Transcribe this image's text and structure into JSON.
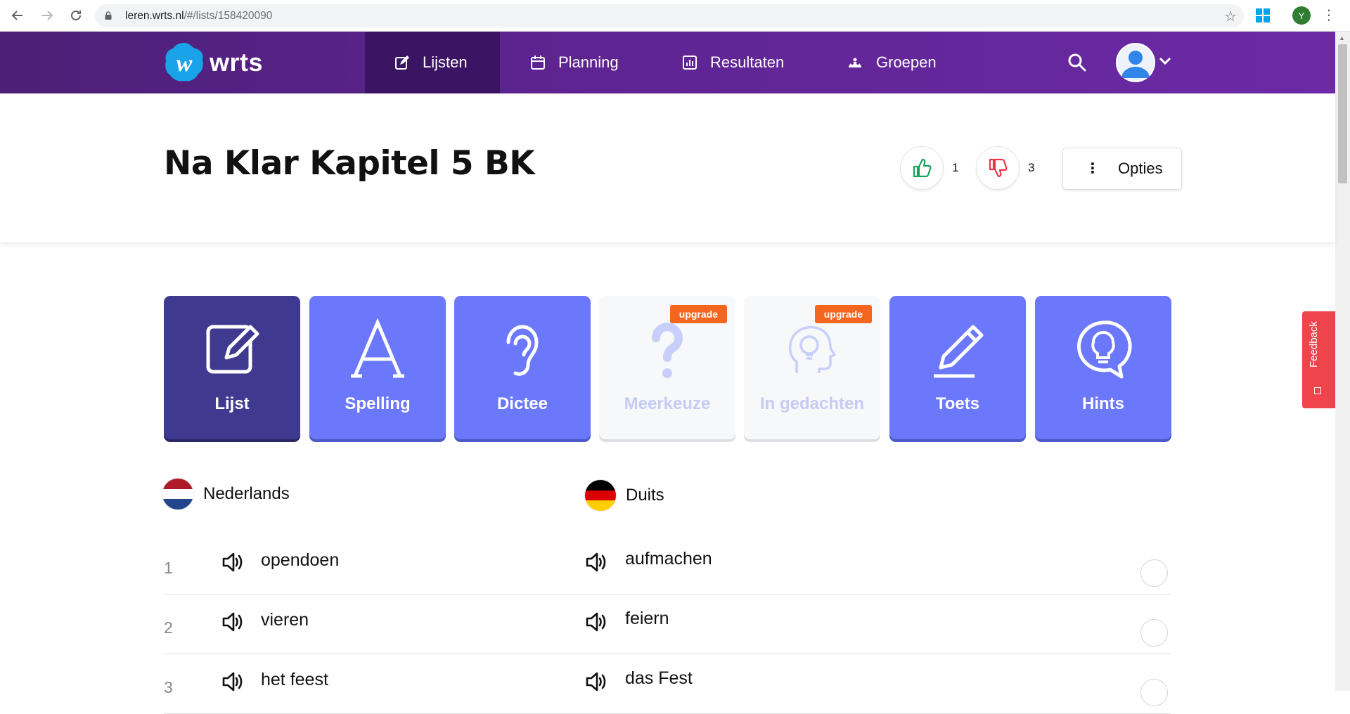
{
  "browser": {
    "url_host": "leren.wrts.nl",
    "url_path": "/#/lists/158420090",
    "profile_initial": "Y"
  },
  "header": {
    "logo_text": "wrts",
    "menu": [
      {
        "label": "Lijsten",
        "icon": "edit-icon",
        "active": true
      },
      {
        "label": "Planning",
        "icon": "calendar-icon",
        "active": false
      },
      {
        "label": "Resultaten",
        "icon": "chart-icon",
        "active": false
      },
      {
        "label": "Groepen",
        "icon": "group-icon",
        "active": false
      }
    ]
  },
  "list": {
    "title": "Na Klar Kapitel 5 BK",
    "likes": "1",
    "dislikes": "3",
    "options_label": "Opties"
  },
  "modes": [
    {
      "label": "Lijst",
      "icon": "edit-list-icon",
      "state": "active"
    },
    {
      "label": "Spelling",
      "icon": "letter-a-icon",
      "state": "normal"
    },
    {
      "label": "Dictee",
      "icon": "ear-icon",
      "state": "normal"
    },
    {
      "label": "Meerkeuze",
      "icon": "question-mark-icon",
      "state": "disabled",
      "badge": "upgrade"
    },
    {
      "label": "In gedachten",
      "icon": "head-bulb-icon",
      "state": "disabled",
      "badge": "upgrade"
    },
    {
      "label": "Toets",
      "icon": "pencil-icon",
      "state": "normal"
    },
    {
      "label": "Hints",
      "icon": "lightbulb-bubble-icon",
      "state": "normal"
    }
  ],
  "feedback_label": "Feedback",
  "languages": {
    "left": "Nederlands",
    "right": "Duits"
  },
  "words": [
    {
      "num": "1",
      "nl": "opendoen",
      "de": "aufmachen"
    },
    {
      "num": "2",
      "nl": "vieren",
      "de": "feiern"
    },
    {
      "num": "3",
      "nl": "het feest",
      "de": "das Fest"
    }
  ],
  "colors": {
    "header_purple": "#5d2490",
    "tile_blue": "#6b78fb",
    "tile_active": "#3f3a8f",
    "upgrade_orange": "#f4651f",
    "feedback_red": "#f0444d"
  }
}
